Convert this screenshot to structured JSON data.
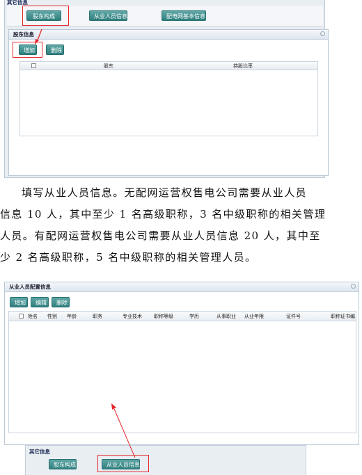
{
  "top_section": {
    "label": "其它信息",
    "buttons": [
      "股东构成",
      "从业人员信息",
      "配电网基本信息"
    ]
  },
  "shareholder_panel": {
    "title": "股东信息",
    "buttons": {
      "add": "增加",
      "delete": "删除"
    },
    "columns": [
      "股东",
      "持股比率"
    ]
  },
  "paragraph": [
    "填写从业人员信息。无配网运营权售电公司需要从业人员",
    "信息 10 人，其中至少 1 名高级职称，3 名中级职称的相关管理",
    "人员。有配网运营权售电公司需要从业人员信息 20 人，其中至",
    "少 2 名高级职称，5 名中级职称的相关管理人员。"
  ],
  "staff_panel": {
    "title": "从业人员配置信息",
    "buttons": {
      "add": "增加",
      "edit": "编辑",
      "delete": "删除"
    },
    "columns": [
      "姓名",
      "性别",
      "年龄",
      "职务",
      "专业技术",
      "职称等级",
      "学历",
      "从事职业",
      "从业年限",
      "证件号",
      "职称证书编"
    ]
  },
  "bottom_section": {
    "label": "其它信息",
    "buttons": [
      "股东构成",
      "从业人员信息"
    ]
  },
  "colors": {
    "button": "#2f7f7e",
    "highlight": "#e4262a",
    "panel_border": "#b9c7d6"
  }
}
